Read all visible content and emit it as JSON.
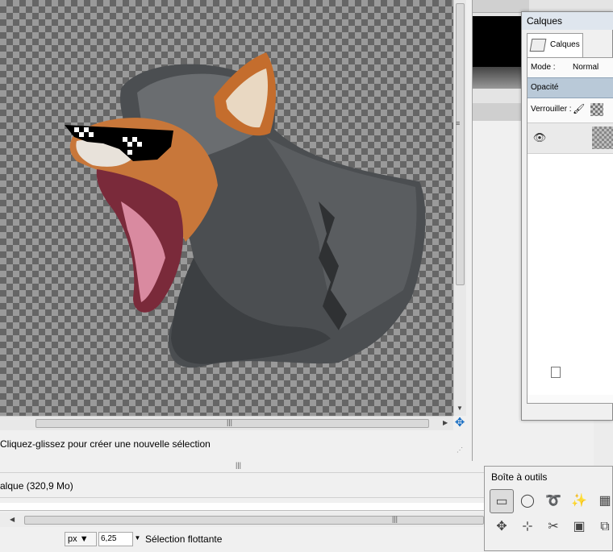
{
  "image_window": {
    "status_message": "Cliquez-glissez pour créer une nouvelle sélection"
  },
  "main_bar": {
    "layer_info": "alque (320,9 Mo)",
    "unit": "px",
    "zoom": "6,25",
    "selection_status": "Sélection flottante"
  },
  "layers_dock": {
    "title": "Calques",
    "tab_label": "Calques",
    "mode_label": "Mode :",
    "mode_value": "Normal",
    "opacity_label": "Opacité",
    "lock_label": "Verrouiller :"
  },
  "toolbox": {
    "title": "Boîte à outils",
    "tools": [
      "rect-select-icon",
      "ellipse-select-icon",
      "lasso-icon",
      "fuzzy-select-icon",
      "color-select-icon",
      "move-icon",
      "align-icon",
      "crop-icon",
      "transform-icon",
      "scale-icon"
    ]
  },
  "colors": {
    "checker_dark": "#666666",
    "checker_light": "#9a9a9a",
    "selected_row": "#b9c9d8",
    "nav_blue": "#1a6fc4"
  }
}
